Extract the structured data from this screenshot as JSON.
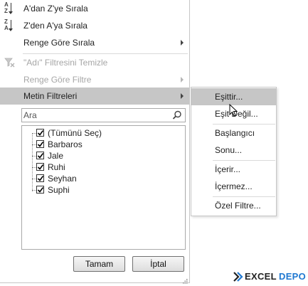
{
  "menu": {
    "items": [
      {
        "label": "A'dan Z'ye Sırala",
        "icon": "sort-ascending-icon",
        "disabled": false,
        "submenu": false
      },
      {
        "label": "Z'den A'ya Sırala",
        "icon": "sort-descending-icon",
        "disabled": false,
        "submenu": false
      },
      {
        "label": "Renge Göre Sırala",
        "icon": "",
        "disabled": false,
        "submenu": true
      },
      {
        "label": "\"Adı\" Filtresini Temizle",
        "icon": "clear-filter-icon",
        "disabled": true,
        "submenu": false
      },
      {
        "label": "Renge Göre Filtre",
        "icon": "",
        "disabled": true,
        "submenu": true
      },
      {
        "label": "Metin Filtreleri",
        "icon": "",
        "disabled": false,
        "submenu": true,
        "highlighted": true
      }
    ],
    "sort_icon_letters": {
      "a": "A",
      "z": "Z"
    }
  },
  "search": {
    "placeholder": "Ara",
    "value": ""
  },
  "list": {
    "items": [
      {
        "label": "(Tümünü Seç)",
        "checked": true
      },
      {
        "label": "Barbaros",
        "checked": true
      },
      {
        "label": "Jale",
        "checked": true
      },
      {
        "label": "Ruhi",
        "checked": true
      },
      {
        "label": "Seyhan",
        "checked": true
      },
      {
        "label": "Suphi",
        "checked": true
      }
    ]
  },
  "buttons": {
    "ok": "Tamam",
    "cancel": "İptal"
  },
  "submenu": {
    "items": [
      {
        "label": "Eşittir...",
        "highlighted": true
      },
      {
        "label": "Eşit Değil..."
      },
      {
        "label": "Başlangıcı"
      },
      {
        "label": "Sonu..."
      },
      {
        "label": "İçerir..."
      },
      {
        "label": "İçermez..."
      },
      {
        "label": "Özel Filtre..."
      }
    ]
  },
  "watermark": {
    "part1": "EXCEL",
    "part2": "DEPO"
  },
  "colors": {
    "highlight": "#c6c6c6",
    "disabled_text": "#a6a6a6",
    "logo_dark": "#222222",
    "logo_accent": "#1f78d1"
  }
}
